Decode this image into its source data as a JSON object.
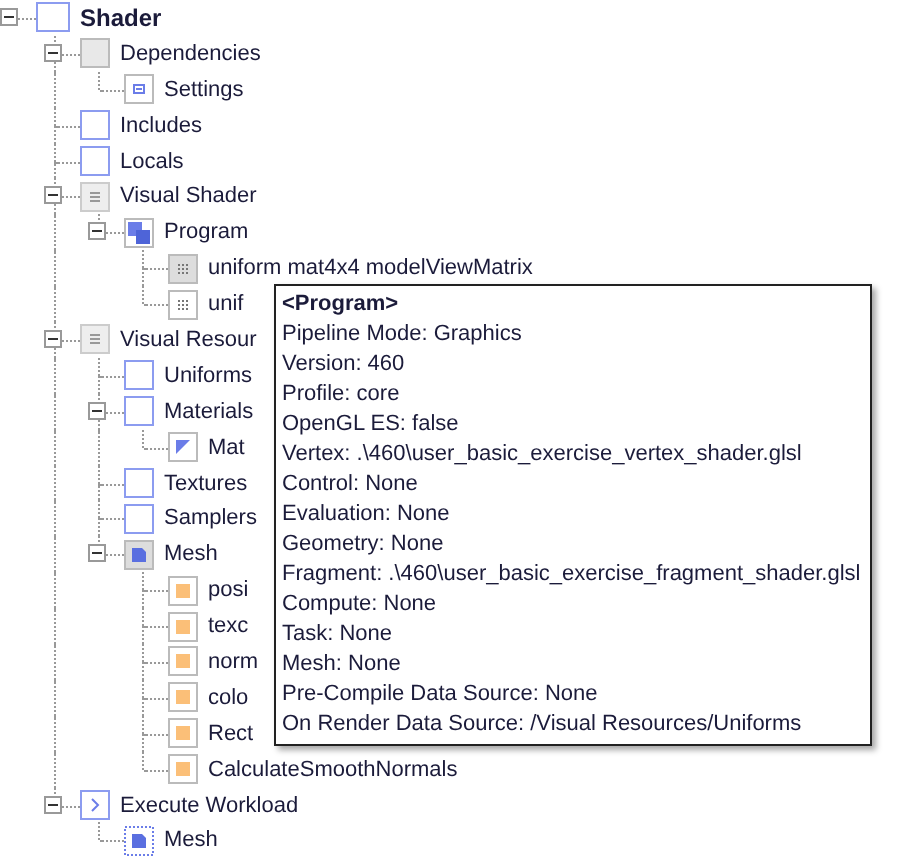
{
  "tree": [
    {
      "label": "Shader",
      "kind": "shader",
      "expanded": true,
      "children": [
        {
          "label": "Dependencies",
          "kind": "dependencies",
          "expanded": true,
          "children": [
            {
              "label": "Settings",
              "kind": "settings"
            }
          ]
        },
        {
          "label": "Includes",
          "kind": "folder"
        },
        {
          "label": "Locals",
          "kind": "folder"
        },
        {
          "label": "Visual Shader",
          "kind": "list",
          "expanded": true,
          "children": [
            {
              "label": "Program",
              "kind": "program",
              "expanded": true,
              "children": [
                {
                  "label": "uniform mat4x4 modelViewMatrix",
                  "kind": "uniform-filled"
                },
                {
                  "label": "unif",
                  "kind": "uniform"
                }
              ]
            }
          ]
        },
        {
          "label": "Visual Resour",
          "kind": "list",
          "expanded": true,
          "children": [
            {
              "label": "Uniforms",
              "kind": "folder"
            },
            {
              "label": "Materials",
              "kind": "folder",
              "expanded": true,
              "children": [
                {
                  "label": "Mat",
                  "kind": "material"
                }
              ]
            },
            {
              "label": "Textures",
              "kind": "folder"
            },
            {
              "label": "Samplers",
              "kind": "folder"
            },
            {
              "label": "Mesh",
              "kind": "mesh",
              "expanded": true,
              "children": [
                {
                  "label": "posi",
                  "kind": "attribute"
                },
                {
                  "label": "texc",
                  "kind": "attribute"
                },
                {
                  "label": "norm",
                  "kind": "attribute"
                },
                {
                  "label": "colo",
                  "kind": "attribute"
                },
                {
                  "label": "Rect",
                  "kind": "attribute"
                },
                {
                  "label": "CalculateSmoothNormals",
                  "kind": "attribute"
                }
              ]
            }
          ]
        },
        {
          "label": "Execute Workload",
          "kind": "execute",
          "expanded": true,
          "children": [
            {
              "label": "Mesh",
              "kind": "mesh-ref"
            }
          ]
        }
      ]
    }
  ],
  "tooltip": {
    "title": "<Program>",
    "lines": [
      "Pipeline Mode: Graphics",
      "Version: 460",
      "Profile: core",
      "OpenGL ES: false",
      "Vertex: .\\460\\user_basic_exercise_vertex_shader.glsl",
      "Control: None",
      "Evaluation: None",
      "Geometry: None",
      "Fragment: .\\460\\user_basic_exercise_fragment_shader.glsl",
      "Compute: None",
      "Task: None",
      "Mesh: None",
      "Pre-Compile Data Source: None",
      "On Render Data Source: /Visual Resources/Uniforms"
    ]
  }
}
